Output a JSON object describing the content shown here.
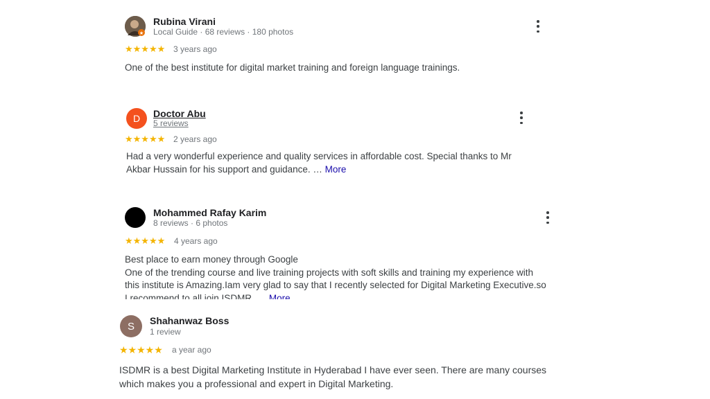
{
  "reviews": [
    {
      "name": "Rubina Virani",
      "meta": "Local Guide · 68 reviews · 180 photos",
      "stars": "★★★★★",
      "date": "3 years ago",
      "text": "One of the best institute for digital market training and foreign language trainings.",
      "avatar_color": "#5a4a3a",
      "badge_color": "#e8710a"
    },
    {
      "name": "Doctor Abu",
      "meta": "5 reviews",
      "avatar_initial": "D",
      "avatar_color": "#f4511e",
      "stars": "★★★★★",
      "date": "2 years ago",
      "text": "Had a very wonderful experience and quality services in affordable cost. Special thanks to Mr Akbar Hussain for his support and guidance. … ",
      "more": "More"
    },
    {
      "name": "Mohammed Rafay Karim",
      "meta": "8 reviews · 6 photos",
      "avatar_color": "#000000",
      "stars": "★★★★★",
      "date": "4 years ago",
      "text_line1": "Best place to earn money through Google",
      "text_rest": "One of the trending course and live training projects with soft skills and training my experience with this institute is Amazing.Iam very glad to say that I recently selected for Digital Marketing Executive.so I recommend to all join ISDMR. … ",
      "more": "More"
    },
    {
      "name": "Shahanwaz Boss",
      "meta": "1 review",
      "avatar_initial": "S",
      "avatar_color": "#8d6e63",
      "stars": "★★★★★",
      "date": "a year ago",
      "text": "ISDMR is a best Digital Marketing Institute in Hyderabad I have ever seen. There are many courses which makes you a professional and expert in Digital Marketing."
    }
  ],
  "colors": {
    "star": "#f4b400",
    "link": "#1a0dab"
  }
}
